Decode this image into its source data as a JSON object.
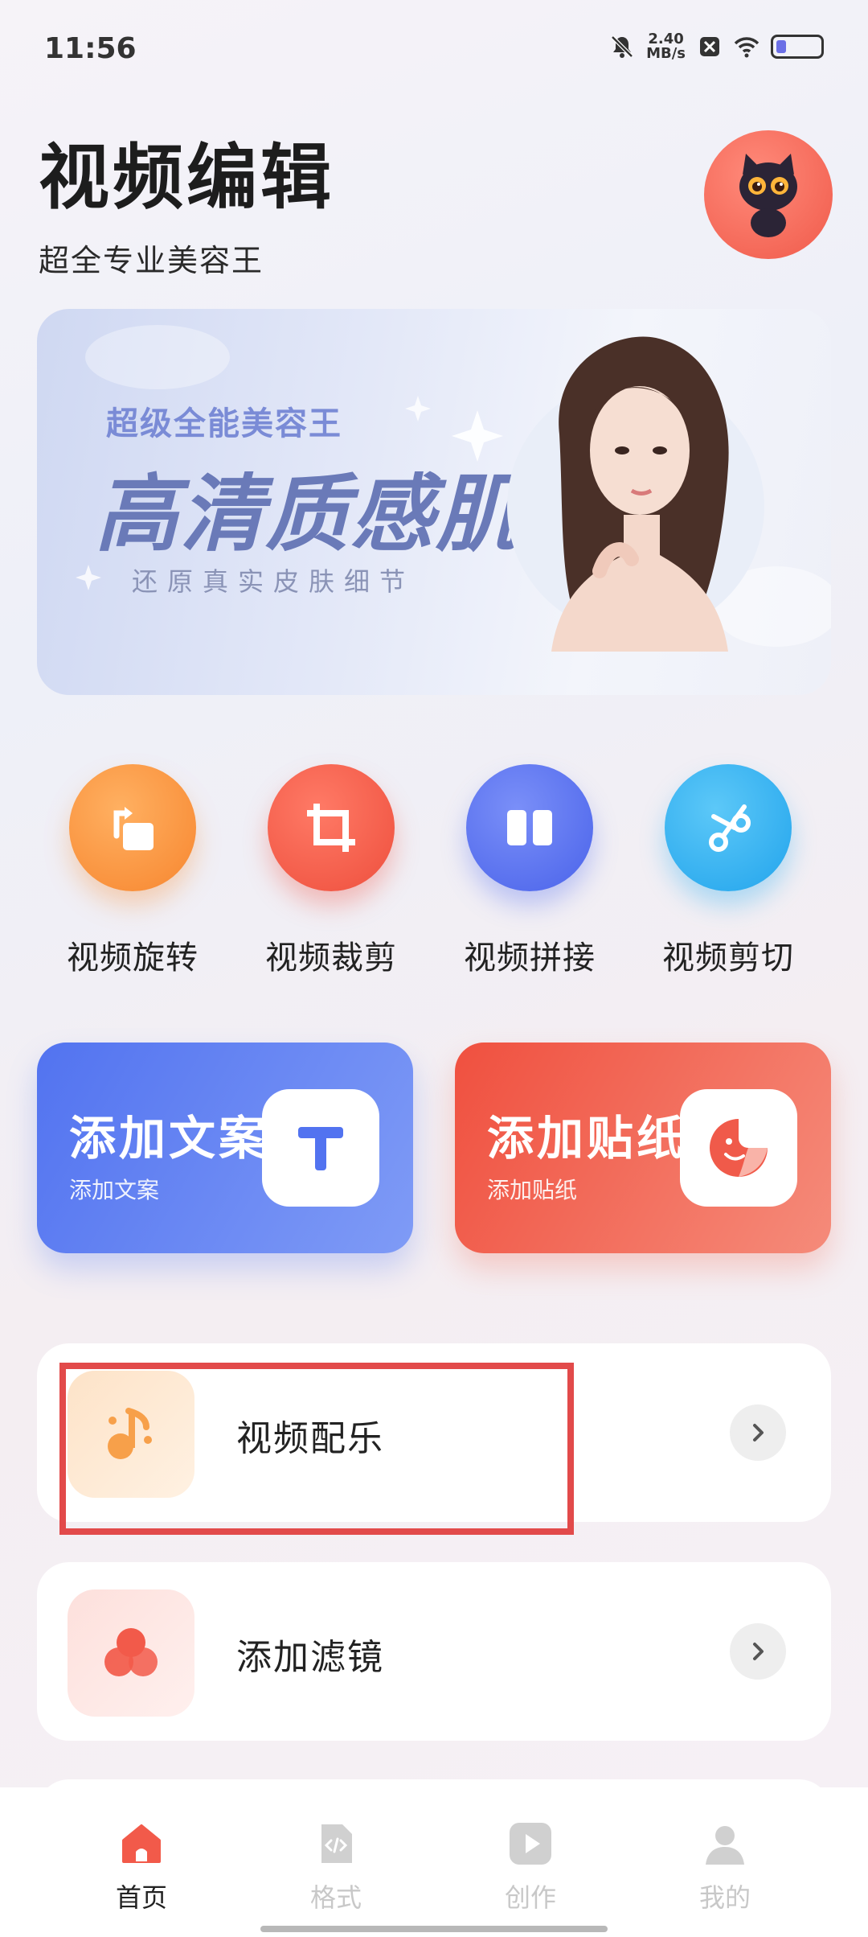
{
  "status_bar": {
    "time": "11:56",
    "speed_value": "2.40",
    "speed_unit": "MB/s",
    "icons": [
      "bell-off-icon",
      "data-off-icon",
      "wifi-icon",
      "battery-icon"
    ]
  },
  "header": {
    "title": "视频编辑",
    "subtitle": "超全专业美容王"
  },
  "banner": {
    "tag": "超级全能美容王",
    "headline": "高清质感肌",
    "caption": "还原真实皮肤细节"
  },
  "tools": [
    {
      "label": "视频旋转",
      "icon": "rotate-icon",
      "color": "#f7923e"
    },
    {
      "label": "视频裁剪",
      "icon": "crop-icon",
      "color": "#f25a4a"
    },
    {
      "label": "视频拼接",
      "icon": "splice-icon",
      "color": "#5a73f0"
    },
    {
      "label": "视频剪切",
      "icon": "scissors-icon",
      "color": "#2fb0f2"
    }
  ],
  "cards": [
    {
      "title": "添加文案",
      "subtitle": "添加文案",
      "icon": "text-t-icon",
      "color": "#5b7ff2"
    },
    {
      "title": "添加贴纸",
      "subtitle": "添加贴纸",
      "icon": "sticker-icon",
      "color": "#f26a55"
    }
  ],
  "list_items": [
    {
      "label": "视频配乐",
      "icon": "music-note-icon",
      "color": "#f7a04a"
    },
    {
      "label": "添加滤镜",
      "icon": "filter-icon",
      "color": "#f25a4a"
    }
  ],
  "tabbar": [
    {
      "label": "首页",
      "icon": "home-icon",
      "active": true
    },
    {
      "label": "格式",
      "icon": "code-file-icon",
      "active": false
    },
    {
      "label": "创作",
      "icon": "play-icon",
      "active": false
    },
    {
      "label": "我的",
      "icon": "person-icon",
      "active": false
    }
  ],
  "colors": {
    "accent": "#f25a4a",
    "highlight": "#e24a4a"
  }
}
